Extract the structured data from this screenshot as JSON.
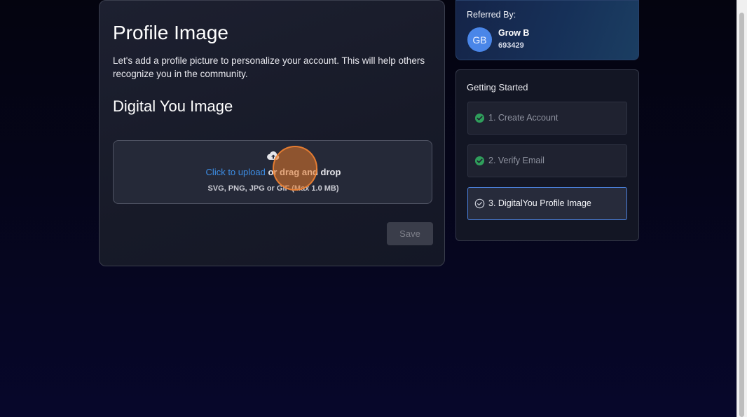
{
  "profile": {
    "title": "Profile Image",
    "description": "Let's add a profile picture to personalize your account. This will help others recognize you in the community.",
    "subtitle": "Digital You Image",
    "upload": {
      "link_text": "Click to upload",
      "rest_text": " or drag and drop",
      "formats": "SVG, PNG, JPG or GIF (Max 1.0 MB)",
      "icon": "cloud-upload-icon"
    },
    "save_label": "Save"
  },
  "referral": {
    "label": "Referred By:",
    "initials": "GB",
    "name": "Grow B",
    "code": "693429"
  },
  "steps": {
    "title": "Getting Started",
    "items": [
      {
        "label": "1. Create Account",
        "status": "complete",
        "icon": "check-circle-icon"
      },
      {
        "label": "2. Verify Email",
        "status": "complete",
        "icon": "check-circle-icon"
      },
      {
        "label": "3. DigitalYou Profile Image",
        "status": "current",
        "icon": "check-circle-outline-icon"
      }
    ]
  },
  "colors": {
    "link": "#3d8ee6",
    "complete": "#2f9e5b",
    "active_border": "#4a7fd9",
    "avatar": "#4a86e8",
    "cursor_highlight": "#e6782a"
  }
}
